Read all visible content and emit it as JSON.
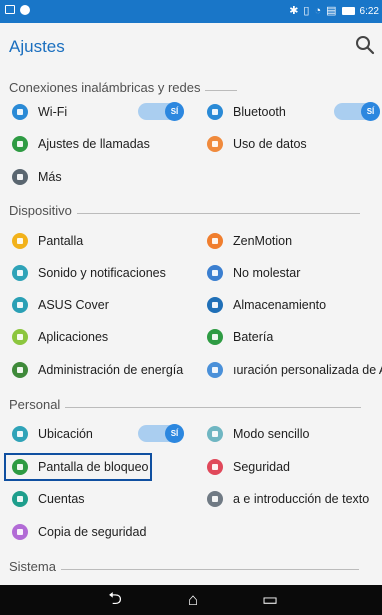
{
  "statusbar": {
    "time": "6:22"
  },
  "appbar": {
    "title": "Ajustes"
  },
  "sections": {
    "wireless": "Conexiones inalámbricas y redes",
    "device": "Dispositivo",
    "personal": "Personal",
    "system": "Sistema"
  },
  "items": {
    "wifi": "Wi-Fi",
    "bluetooth": "Bluetooth",
    "calls": "Ajustes de llamadas",
    "data": "Uso de datos",
    "more": "Más",
    "display": "Pantalla",
    "zenmotion": "ZenMotion",
    "sound": "Sonido y notificaciones",
    "dnd": "No molestar",
    "cover": "ASUS Cover",
    "storage": "Almacenamiento",
    "apps": "Aplicaciones",
    "battery": "Batería",
    "power": "Administración de energía",
    "custom": "ıuración personalizada de A",
    "location": "Ubicación",
    "easy": "Modo sencillo",
    "lock": "Pantalla de bloqueo",
    "security": "Seguridad",
    "accounts": "Cuentas",
    "language": "a e introducción de texto",
    "backup": "Copia de seguridad"
  },
  "toggles": {
    "on_label": "SÍ"
  },
  "colors": {
    "accent": "#1b6fbf",
    "statusbar": "#1976c8",
    "toggle_track": "#aacef0",
    "toggle_knob": "#2c87df"
  }
}
